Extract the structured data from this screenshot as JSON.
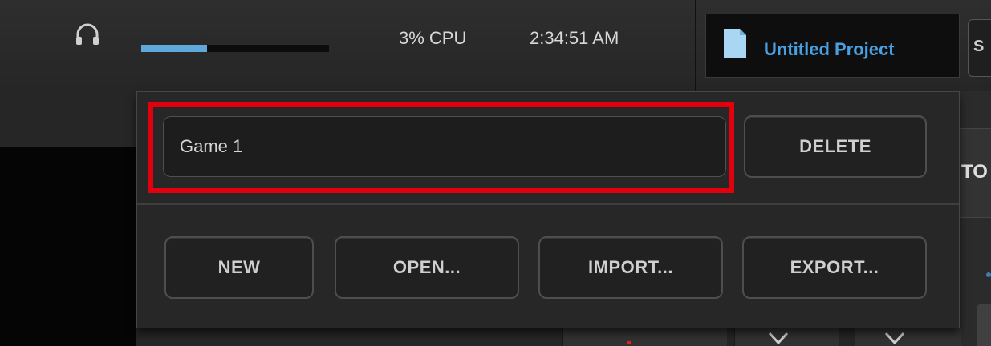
{
  "topbar": {
    "audio_level_fraction": 0.35,
    "cpu": "3% CPU",
    "clock": "2:34:51 AM",
    "project_name": "Untitled Project",
    "edge_button": "S"
  },
  "right_panel": {
    "button_text": "TO"
  },
  "popup": {
    "name_value": "Game 1",
    "delete_label": "DELETE",
    "new_label": "NEW",
    "open_label": "OPEN...",
    "import_label": "IMPORT...",
    "export_label": "EXPORT..."
  },
  "colors": {
    "highlight": "#e2000c",
    "accent": "#4a9fe0",
    "meter": "#5fa8dc"
  },
  "icons": [
    "headphones-icon",
    "document-icon",
    "chevron-down-icon"
  ]
}
